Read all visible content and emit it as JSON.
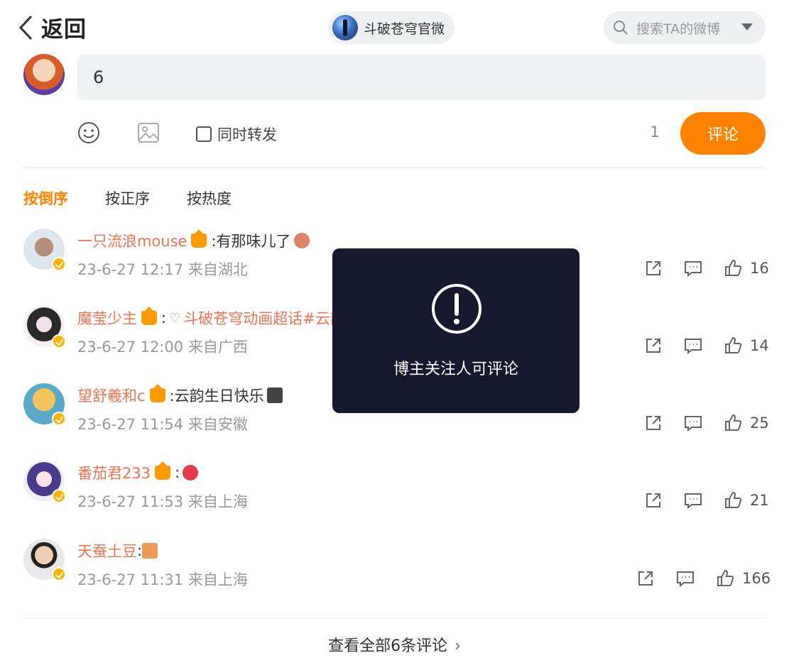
{
  "header": {
    "back_label": "返回",
    "blogger_name": "斗破苍穹官微",
    "search_placeholder": "搜索TA的微博"
  },
  "composer": {
    "input_value": "6",
    "repost_label": "同时转发",
    "char_count": "1",
    "submit_label": "评论"
  },
  "sort_tabs": [
    {
      "label": "按倒序",
      "active": true
    },
    {
      "label": "按正序",
      "active": false
    },
    {
      "label": "按热度",
      "active": false
    }
  ],
  "comments": [
    {
      "user": "一只流浪mouse",
      "text": ":有那味儿了",
      "topic": "",
      "time": "23-6-27 12:17 来自湖北",
      "likes": "16"
    },
    {
      "user": "魔莹少主",
      "text": ":",
      "topic": "斗破苍穹动画超话#云韵#",
      "time": "23-6-27 12:00 来自广西",
      "likes": "14"
    },
    {
      "user": "望舒羲和c",
      "text": ":云韵生日快乐",
      "topic": "",
      "time": "23-6-27 11:54 来自安徽",
      "likes": "25"
    },
    {
      "user": "番茄君233",
      "text": ":",
      "topic": "",
      "time": "23-6-27 11:53 来自上海",
      "likes": "21"
    },
    {
      "user": "天蚕土豆",
      "text": ":",
      "topic": "",
      "time": "23-6-27 11:31 来自上海",
      "likes": "166"
    }
  ],
  "footer": {
    "view_all": "查看全部6条评论"
  },
  "toast": {
    "message": "博主关注人可评论"
  },
  "colors": {
    "accent": "#ff8200",
    "username": "#eb7350",
    "toast_bg": "#161830"
  }
}
